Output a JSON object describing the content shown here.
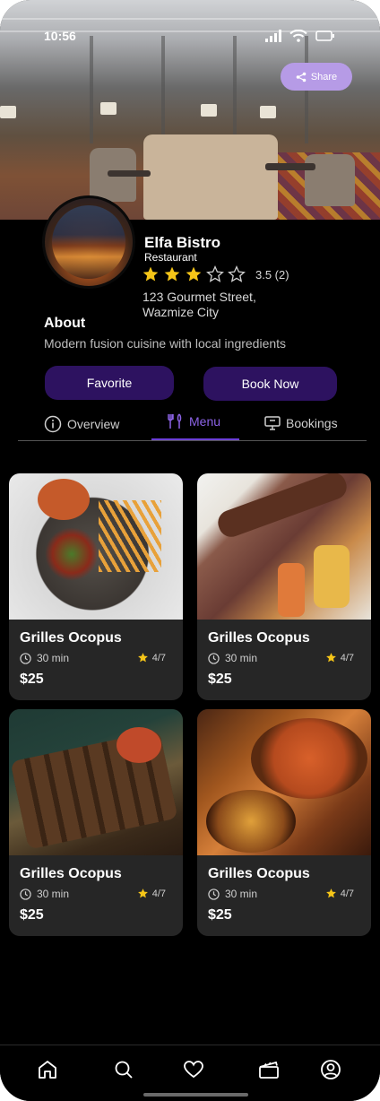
{
  "status_bar": {
    "time": "10:56"
  },
  "hero": {
    "share_label": "Share"
  },
  "restaurant": {
    "name": "Elfa Bistro",
    "type": "Restaurant",
    "rating_text": "3.5 (2)",
    "rating_value": 3,
    "rating_max": 5,
    "address_line1": "123 Gourmet Street,",
    "address_line2": "Wazmize City"
  },
  "about": {
    "title": "About",
    "text": "Modern fusion cuisine with local ingredients"
  },
  "actions": {
    "favorite_label": "Favorite",
    "book_label": "Book Now"
  },
  "tabs": [
    {
      "label": "Overview",
      "icon": "info-icon",
      "active": false
    },
    {
      "label": "Menu",
      "icon": "utensils-icon",
      "active": true
    },
    {
      "label": "Bookings",
      "icon": "monitor-icon",
      "active": false
    }
  ],
  "menu_items": [
    {
      "title": "Grilles Ocopus",
      "time": "30 min",
      "rating": "4/7",
      "price": "$25"
    },
    {
      "title": "Grilles Ocopus",
      "time": "30 min",
      "rating": "4/7",
      "price": "$25"
    },
    {
      "title": "Grilles Ocopus",
      "time": "30 min",
      "rating": "4/7",
      "price": "$25"
    },
    {
      "title": "Grilles Ocopus",
      "time": "30 min",
      "rating": "4/7",
      "price": "$25"
    }
  ],
  "nav": [
    "home-icon",
    "search-icon",
    "heart-icon",
    "clapperboard-icon",
    "profile-icon"
  ],
  "colors": {
    "accent": "#2d1260",
    "tab_active": "#8c63e6",
    "share": "#b69be6",
    "star": "#f5c518",
    "card_bg": "#262626"
  }
}
